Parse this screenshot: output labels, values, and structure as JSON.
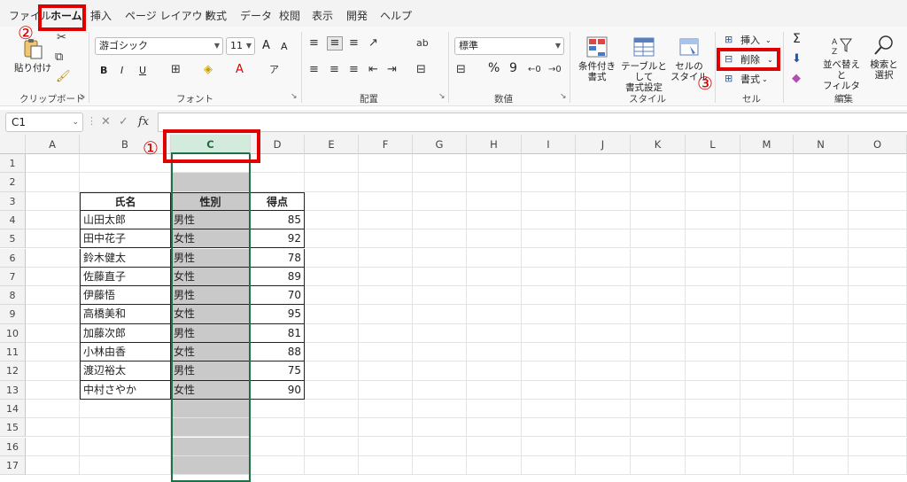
{
  "menu": {
    "tabs": [
      "ファイル",
      "ホーム",
      "挿入",
      "ページ レイアウト",
      "数式",
      "データ",
      "校閲",
      "表示",
      "開発",
      "ヘルプ"
    ],
    "active": "ホーム"
  },
  "ribbon": {
    "clipboard": {
      "label": "クリップボード",
      "paste": "貼り付け"
    },
    "font": {
      "label": "フォント",
      "font_name": "游ゴシック",
      "font_size": "11",
      "bold": "B",
      "italic": "I",
      "underline": "U",
      "grow": "A",
      "shrink": "A"
    },
    "alignment": {
      "label": "配置"
    },
    "number": {
      "label": "数値",
      "format": "標準",
      "percent": "%",
      "comma": "9"
    },
    "styles": {
      "label": "スタイル",
      "conditional": [
        "条件付き",
        "書式"
      ],
      "table": [
        "テーブルとして",
        "書式設定"
      ],
      "cell_styles": [
        "セルの",
        "スタイル"
      ]
    },
    "cells": {
      "label": "セル",
      "insert": "挿入",
      "delete": "削除",
      "format": "書式"
    },
    "editing": {
      "label": "編集",
      "sum": "Σ",
      "sort": [
        "並べ替えと",
        "フィルター"
      ],
      "find": [
        "検索と",
        "選択"
      ]
    }
  },
  "formula_bar": {
    "name_box": "C1",
    "fx": "fx",
    "formula": ""
  },
  "grid": {
    "columns": [
      "A",
      "B",
      "C",
      "D",
      "E",
      "F",
      "G",
      "H",
      "I",
      "J",
      "K",
      "L",
      "M",
      "N",
      "O"
    ],
    "selected_column": "C",
    "rows": [
      "1",
      "2",
      "3",
      "4",
      "5",
      "6",
      "7",
      "8",
      "9",
      "10",
      "11",
      "12",
      "13",
      "14",
      "15",
      "16",
      "17"
    ],
    "table": {
      "headers": [
        "氏名",
        "性別",
        "得点"
      ],
      "rows": [
        [
          "山田太郎",
          "男性",
          "85"
        ],
        [
          "田中花子",
          "女性",
          "92"
        ],
        [
          "鈴木健太",
          "男性",
          "78"
        ],
        [
          "佐藤直子",
          "女性",
          "89"
        ],
        [
          "伊藤悟",
          "男性",
          "70"
        ],
        [
          "高橋美和",
          "女性",
          "95"
        ],
        [
          "加藤次郎",
          "男性",
          "81"
        ],
        [
          "小林由香",
          "女性",
          "88"
        ],
        [
          "渡辺裕太",
          "男性",
          "75"
        ],
        [
          "中村さやか",
          "女性",
          "90"
        ]
      ]
    }
  },
  "annotations": {
    "step1": "①",
    "step2": "②",
    "step3": "③"
  },
  "colors": {
    "accent": "#1e7145",
    "highlight": "#e00000",
    "selection": "#c9c9c9"
  }
}
